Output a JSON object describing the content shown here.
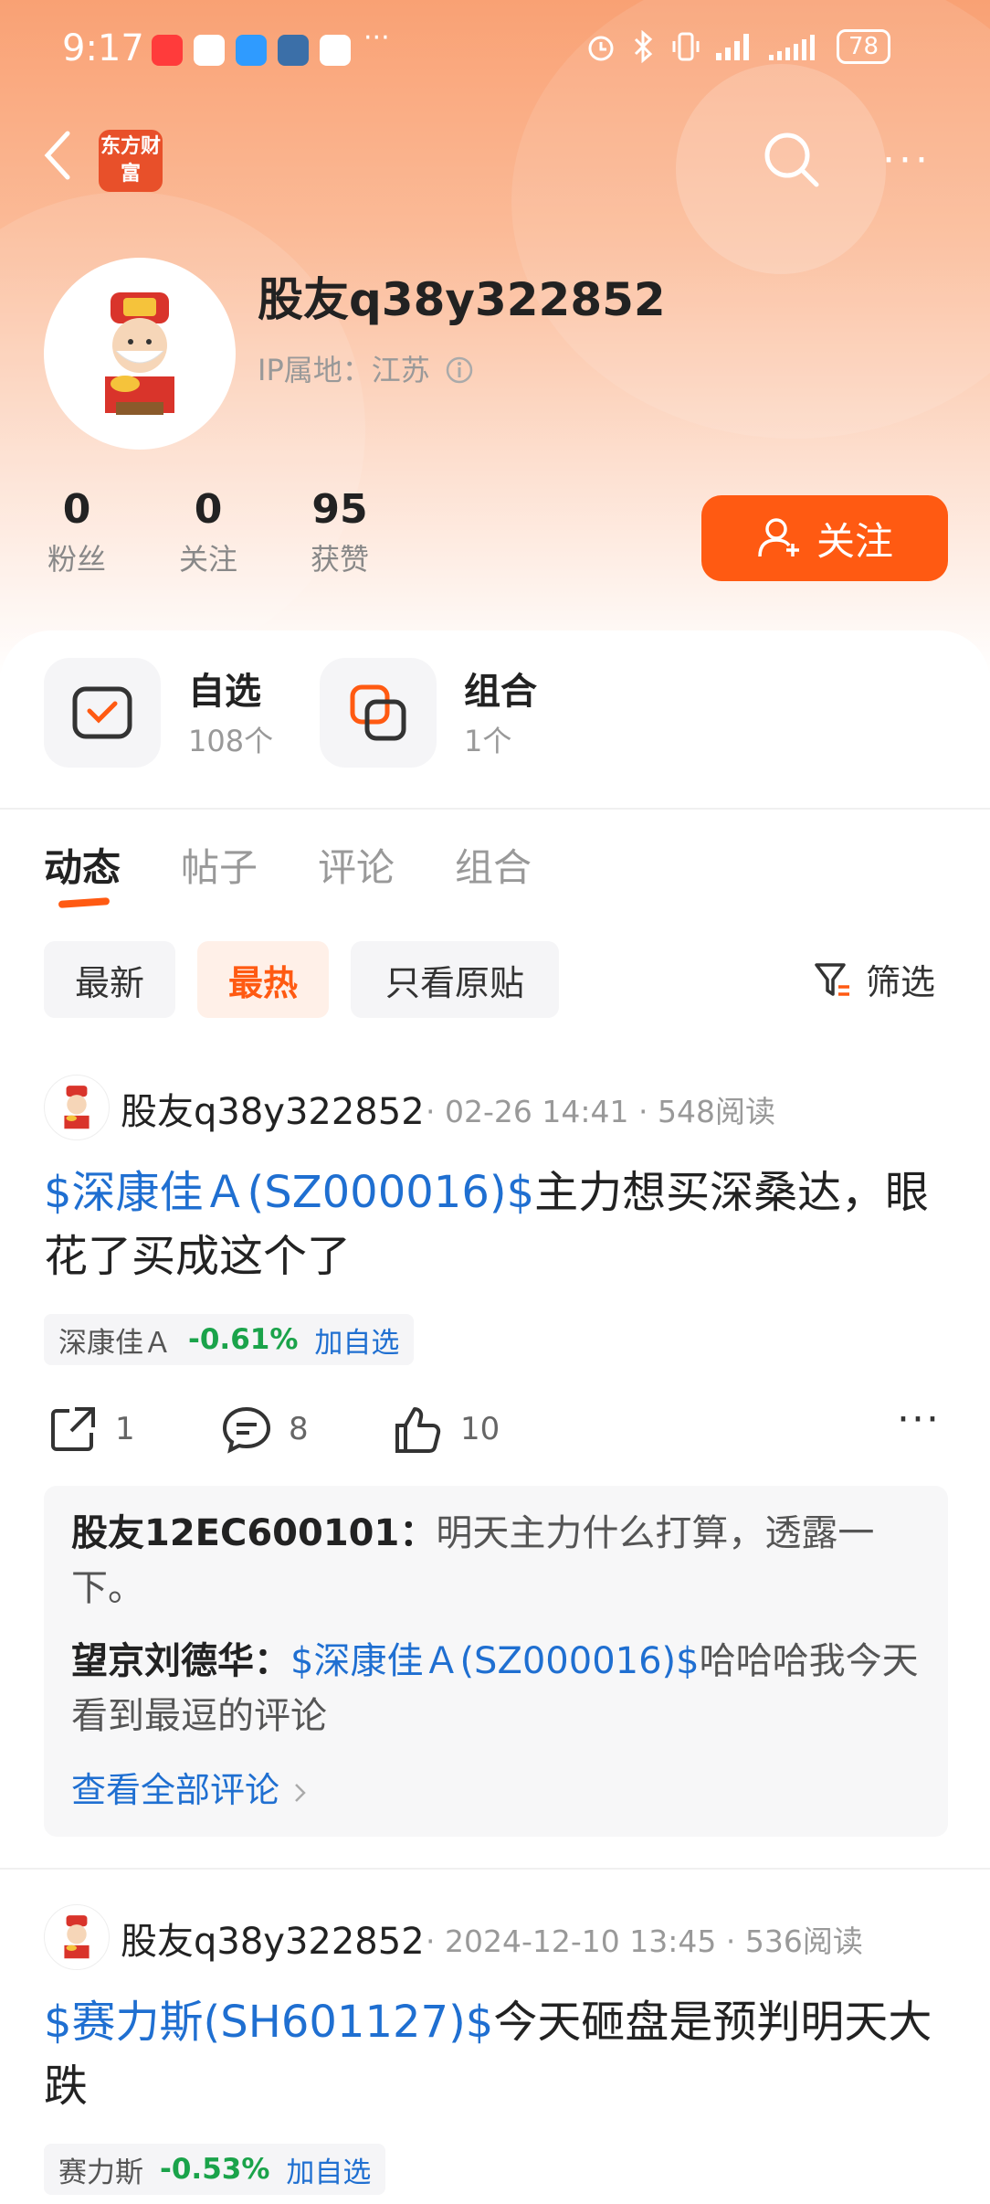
{
  "status_bar": {
    "time": "9:17",
    "battery": "78",
    "more": "···"
  },
  "header": {
    "logo_text": "东方财富",
    "more": "···"
  },
  "profile": {
    "username": "股友q38y322852",
    "ip_label": "IP属地：江苏",
    "stats": [
      {
        "value": "0",
        "label": "粉丝"
      },
      {
        "value": "0",
        "label": "关注"
      },
      {
        "value": "95",
        "label": "获赞"
      }
    ],
    "follow_label": "关注"
  },
  "quick": [
    {
      "title": "自选",
      "sub": "108个",
      "icon": "watchlist-icon"
    },
    {
      "title": "组合",
      "sub": "1个",
      "icon": "portfolio-icon"
    }
  ],
  "tabs": [
    "动态",
    "帖子",
    "评论",
    "组合"
  ],
  "filters": [
    "最新",
    "最热",
    "只看原贴"
  ],
  "filter_label": "筛选",
  "posts": [
    {
      "author": "股友q38y322852",
      "time": "02-26 14:41",
      "reads": "548阅读",
      "stock_link": "$深康佳Ａ(SZ000016)$",
      "text": "主力想买深桑达，眼花了买成这个了",
      "tag": {
        "name": "深康佳Ａ",
        "change": "-0.61%",
        "add": "加自选"
      },
      "actions": {
        "share": "1",
        "comment": "8",
        "like": "10"
      },
      "comments": [
        {
          "user": "股友12EC600101：",
          "link": "",
          "text": "明天主力什么打算，透露一下。"
        },
        {
          "user": "望京刘德华：",
          "link": "$深康佳Ａ(SZ000016)$",
          "text": "哈哈哈我今天看到最逗的评论"
        }
      ],
      "view_all": "查看全部评论"
    },
    {
      "author": "股友q38y322852",
      "time": "2024-12-10 13:45",
      "reads": "536阅读",
      "stock_link": "$赛力斯(SH601127)$",
      "text": "今天砸盘是预判明天大跌",
      "tag": {
        "name": "赛力斯",
        "change": "-0.53%",
        "add": "加自选"
      }
    }
  ],
  "colors": {
    "accent": "#ff5a12",
    "link": "#1f6fd1",
    "down": "#1aa34a"
  }
}
